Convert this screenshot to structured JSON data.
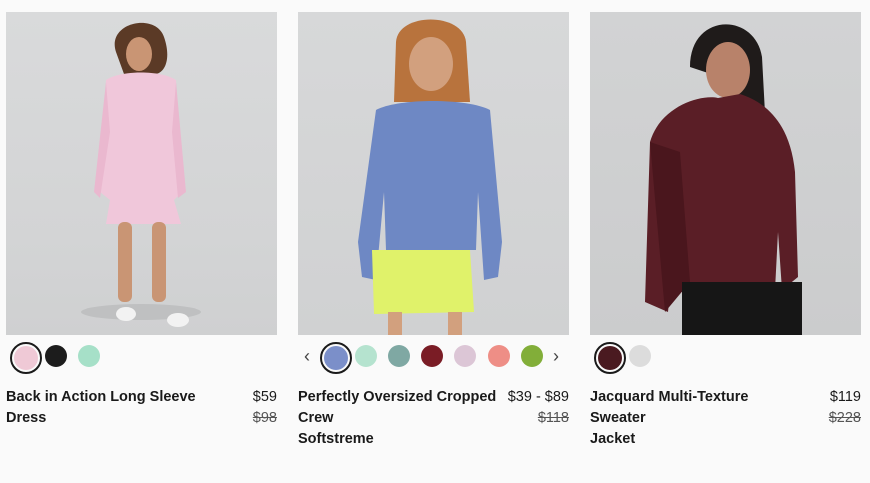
{
  "products": [
    {
      "name": "Back in Action Long Sleeve Dress",
      "price": "$59",
      "original_price": "$98",
      "swatches": [
        "#efc9d6",
        "#1c1c1c",
        "#a6e0c8"
      ]
    },
    {
      "name_line1": "Perfectly Oversized Cropped",
      "name_line2": "Crew",
      "name_line3": "Softstreme",
      "price": "$39 - $89",
      "original_price": "$118",
      "prev_arrow": "‹",
      "next_arrow": "›",
      "swatches": [
        "#7b8fc9",
        "#b5e3cf",
        "#7fa8a3",
        "#7a1c25",
        "#dcc6d6",
        "#ee8e86",
        "#82ae39"
      ]
    },
    {
      "name_line1": "Jacquard Multi-Texture Sweater",
      "name_line2": "Jacket",
      "price": "$119",
      "original_price": "$228",
      "swatches": [
        "#4a1a20",
        "#dcdcdc"
      ]
    }
  ]
}
